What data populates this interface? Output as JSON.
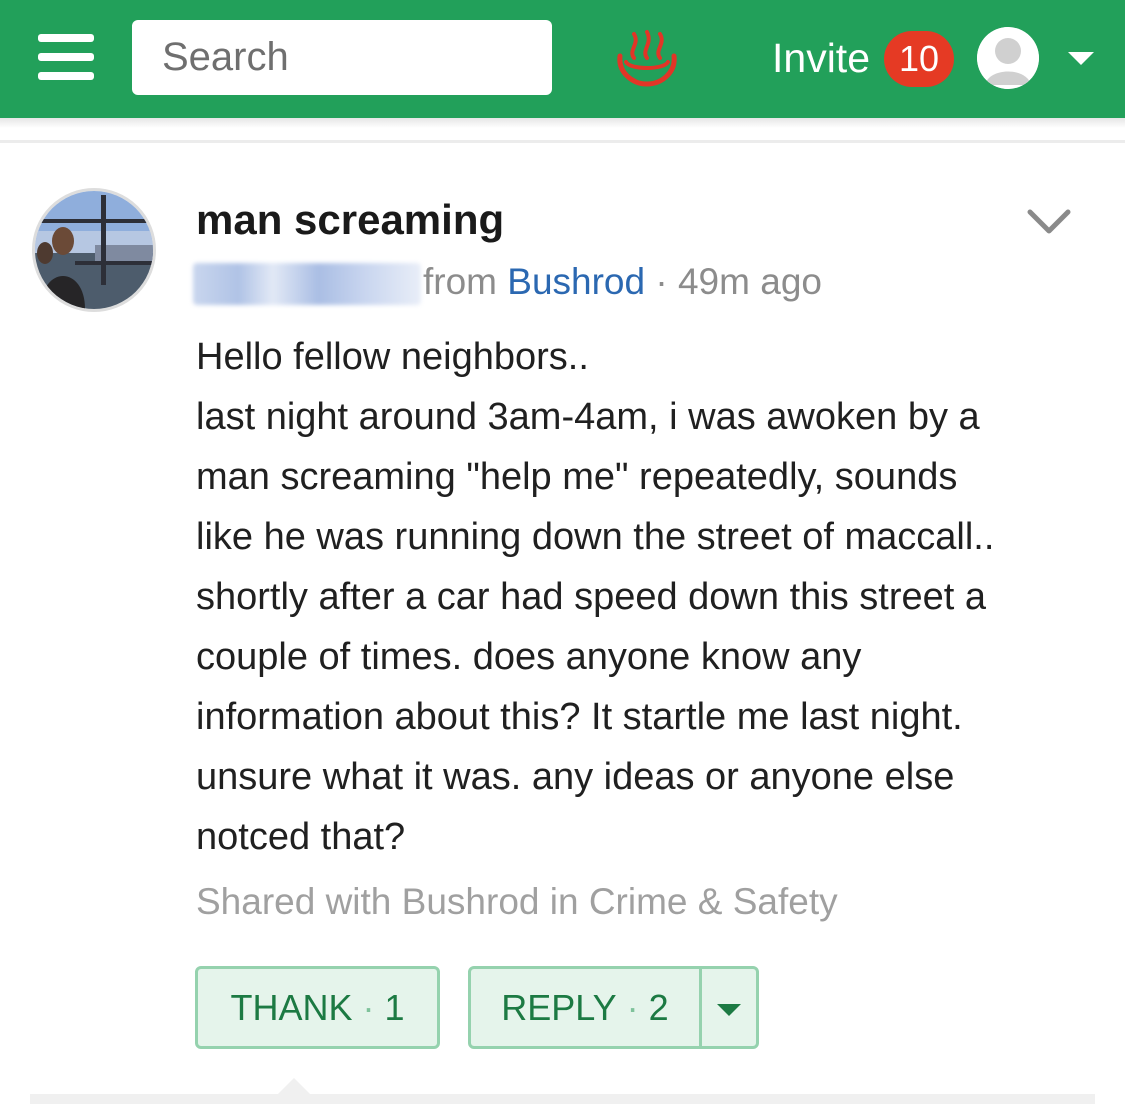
{
  "header": {
    "search_placeholder": "Search",
    "invite_label": "Invite",
    "invite_count": "10",
    "brand_color": "#22a05a",
    "badge_color": "#e53a24"
  },
  "post": {
    "title": "man screaming",
    "meta_from": "from",
    "neighborhood": "Bushrod",
    "meta_separator": "·",
    "time_ago": "49m ago",
    "body_lines": [
      "Hello fellow neighbors..",
      "last night around 3am-4am, i was awoken by a",
      "man screaming \"help me\" repeatedly, sounds",
      "like he was running down the street of maccall..",
      "shortly after a car had speed down this street a",
      "couple of times. does anyone know any",
      "information about this? It startle me last night.",
      "unsure what it was. any ideas or anyone else",
      "notced that?"
    ],
    "shared_with": "Shared with Bushrod in Crime & Safety",
    "thank_label": "THANK",
    "thank_count": "1",
    "reply_label": "REPLY",
    "reply_count": "2",
    "button_separator": "·",
    "link_color": "#2b68b1",
    "button_text_color": "#1c7a43"
  },
  "icons": {
    "menu": "hamburger-menu-icon",
    "logo": "hot-springs-logo-icon",
    "profile": "user-avatar-icon",
    "dropdown": "caret-down-icon",
    "collapse": "chevron-down-icon"
  }
}
